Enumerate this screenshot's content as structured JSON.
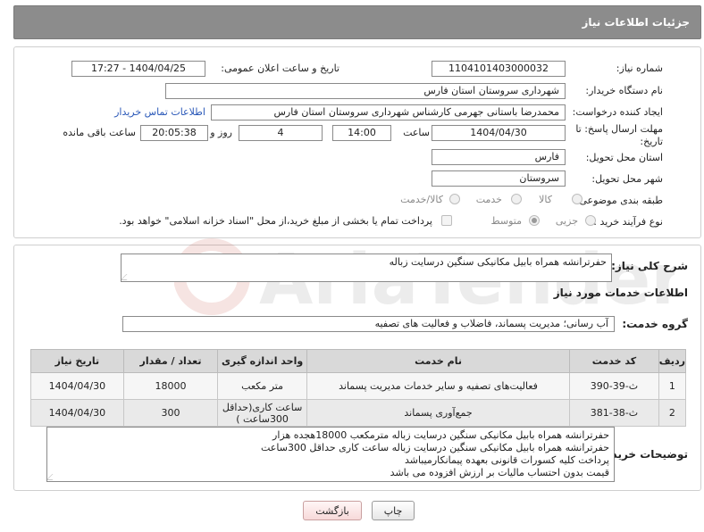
{
  "header": {
    "title": "جزئیات اطلاعات نیاز"
  },
  "form": {
    "need_number_label": "شماره نیاز:",
    "need_number": "1104101403000032",
    "announce_label": "تاریخ و ساعت اعلان عمومی:",
    "announce_value": "1404/04/25 - 17:27",
    "buyer_org_label": "نام دستگاه خریدار:",
    "buyer_org": "شهرداری سروستان استان فارس",
    "creator_label": "ایجاد کننده درخواست:",
    "creator": "محمدرضا باستانی جهرمی کارشناس شهرداری سروستان استان فارس",
    "contact_link": "اطلاعات تماس خریدار",
    "deadline_label_1": "مهلت ارسال پاسخ: تا",
    "deadline_label_2": "تاریخ:",
    "deadline_date": "1404/04/30",
    "time_label": "ساعت",
    "deadline_time": "14:00",
    "day_label": "روز و",
    "days": "4",
    "remaining_time": "20:05:38",
    "remaining_label": "ساعت باقی مانده",
    "province_label": "استان محل تحویل:",
    "province": "فارس",
    "city_label": "شهر محل تحویل:",
    "city": "سروستان",
    "category_label": "طبقه بندی موضوعی:",
    "category_options": [
      "کالا",
      "خدمت",
      "کالا/خدمت"
    ],
    "purchase_type_label": "نوع فرآیند خرید :",
    "purchase_options": [
      "جزیی",
      "متوسط"
    ],
    "treasury_note": "پرداخت تمام یا بخشی از مبلغ خرید،از محل \"اسناد خزانه اسلامی\" خواهد بود."
  },
  "details": {
    "summary_label": "شرح کلی نیاز:",
    "summary": "حفرترانشه همراه بابیل مکانیکی سنگین درسایت زباله",
    "services_title": "اطلاعات خدمات مورد نیاز",
    "service_group_label": "گروه خدمت:",
    "service_group": "آب رسانی؛ مدیریت پسماند، فاضلاب و فعالیت های تصفیه",
    "table": {
      "headers": [
        "ردیف",
        "کد خدمت",
        "نام خدمت",
        "واحد اندازه گیری",
        "تعداد / مقدار",
        "تاریخ نیاز"
      ],
      "rows": [
        [
          "1",
          "ث-39-390",
          "فعالیت‌های تصفیه و سایر خدمات مدیریت پسماند",
          "متر مکعب",
          "18000",
          "1404/04/30"
        ],
        [
          "2",
          "ث-38-381",
          "جمع‌آوری پسماند",
          "ساعت کاری(حداقل 300ساعت )",
          "300",
          "1404/04/30"
        ]
      ]
    },
    "buyer_notes_label": "توضیحات خریدار:",
    "buyer_notes": [
      "حفرترانشه همراه بابیل مکانیکی سنگین درسایت زباله مترمکعب 18000هجده هزار",
      "حفرترانشه همراه بابیل مکانیکی سنگین درسایت زباله ساعت کاری حداقل 300ساعت",
      "پرداخت کلیه کسورات قانونی بعهده پیمانکارمیباشد",
      "قیمت بدون احتساب مالیات بر ارزش افزوده می باشد"
    ]
  },
  "buttons": {
    "print": "چاپ",
    "back": "بازگشت"
  },
  "watermark": {
    "text": "AriaTender.net"
  }
}
